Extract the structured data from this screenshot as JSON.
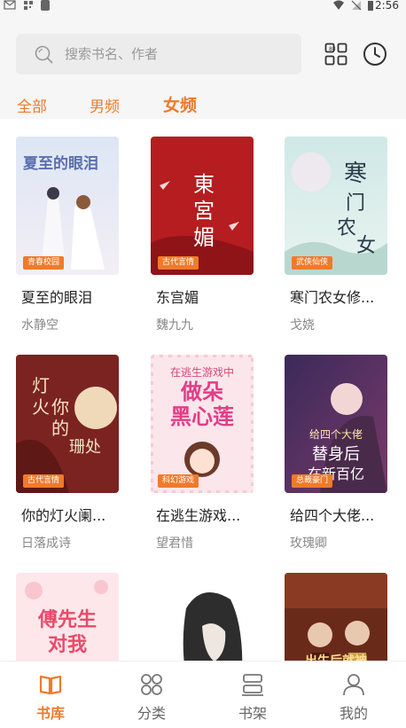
{
  "status_bar": {
    "time": "2:56"
  },
  "search": {
    "placeholder": "搜索书名、作者"
  },
  "tabs": [
    {
      "label": "全部"
    },
    {
      "label": "男频"
    },
    {
      "label": "女频",
      "active": true
    }
  ],
  "books": [
    {
      "title": "夏至的眼泪",
      "author": "水静空",
      "tag": "青春校园",
      "cover_text": "夏至的眼泪"
    },
    {
      "title": "东宫媚",
      "author": "魏九九",
      "tag": "古代言情",
      "cover_text": "東宮媚"
    },
    {
      "title": "寒门农女修...",
      "author": "戈娆",
      "tag": "武侠仙侠",
      "cover_text": "寒门农女"
    },
    {
      "title": "你的灯火阑...",
      "author": "日落成诗",
      "tag": "古代言情",
      "cover_text": "你的灯火阑珊处"
    },
    {
      "title": "在逃生游戏...",
      "author": "望君惜",
      "tag": "科幻游戏",
      "cover_text": "在逃生游戏中做朵黑心莲"
    },
    {
      "title": "给四个大佬...",
      "author": "玫瑰卿",
      "tag": "总裁豪门",
      "cover_text": "给四个大佬替身后我在新百亿"
    },
    {
      "title": "",
      "author": "",
      "tag": "",
      "cover_text": "傅先生对我"
    },
    {
      "title": "",
      "author": "",
      "tag": "",
      "cover_text": ""
    },
    {
      "title": "",
      "author": "",
      "tag": "",
      "cover_text": "出生后就被"
    }
  ],
  "bottom_nav": [
    {
      "label": "书库",
      "icon": "book-open-icon",
      "active": true
    },
    {
      "label": "分类",
      "icon": "category-icon"
    },
    {
      "label": "书架",
      "icon": "bookshelf-icon"
    },
    {
      "label": "我的",
      "icon": "user-icon"
    }
  ],
  "colors": {
    "accent": "#f07a2a",
    "background": "#f6f6f6"
  }
}
